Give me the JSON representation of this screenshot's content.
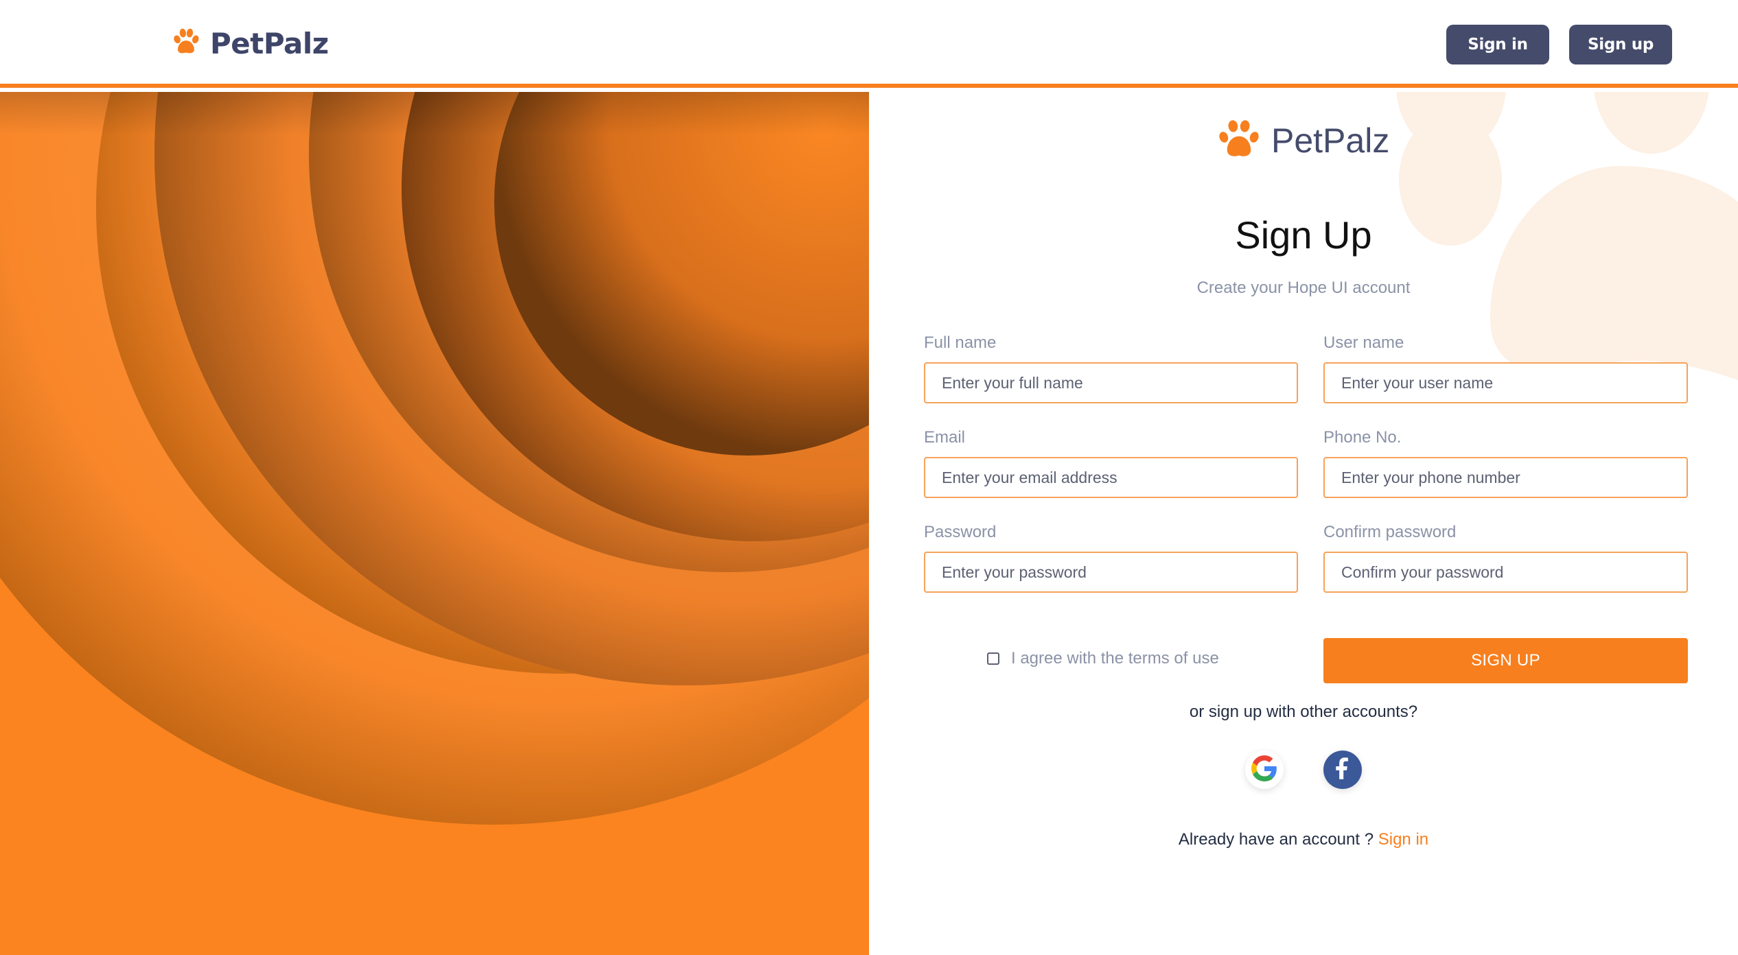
{
  "header": {
    "brand_name": "PetPalz",
    "signin_label": "Sign in",
    "signup_label": "Sign up"
  },
  "form": {
    "brand_name": "PetPalz",
    "title": "Sign Up",
    "subtitle": "Create your Hope UI account",
    "fields": [
      {
        "label": "Full name",
        "placeholder": "Enter your full name",
        "value": ""
      },
      {
        "label": "User name",
        "placeholder": "Enter your user name",
        "value": ""
      },
      {
        "label": "Email",
        "placeholder": "Enter your email address",
        "value": ""
      },
      {
        "label": "Phone No.",
        "placeholder": "Enter your phone number",
        "value": ""
      },
      {
        "label": "Password",
        "placeholder": "Enter your password",
        "value": ""
      },
      {
        "label": "Confirm password",
        "placeholder": "Confirm your password",
        "value": ""
      }
    ],
    "terms_label": "I agree with the terms of use",
    "terms_checked": false,
    "submit_label": "SIGN UP",
    "alt_signup_text": "or sign up with other accounts?",
    "social": [
      {
        "name": "google",
        "icon": "google-icon"
      },
      {
        "name": "facebook",
        "icon": "facebook-icon"
      }
    ],
    "have_account_text": "Already have an account ?",
    "signin_link": "Sign in"
  },
  "colors": {
    "accent": "#f77f1e",
    "nav_button": "#454b6b",
    "brand_text": "#3e4569",
    "muted_text": "#8a92a6",
    "input_border": "#f6a25a",
    "paw_watermark": "#fdf0e4"
  }
}
